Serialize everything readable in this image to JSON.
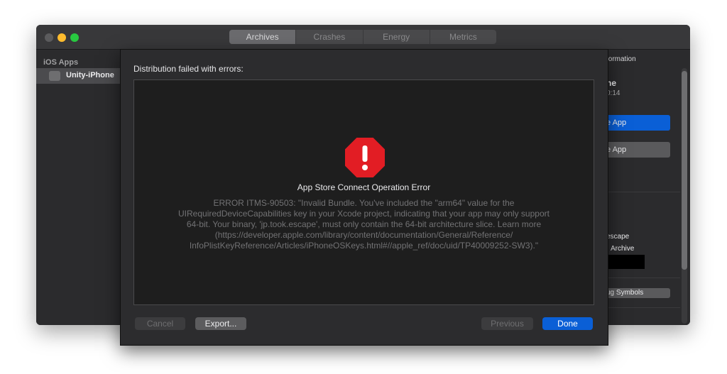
{
  "window": {
    "tabs": [
      {
        "label": "Archives",
        "active": true
      },
      {
        "label": "Crashes",
        "active": false
      },
      {
        "label": "Energy",
        "active": false
      },
      {
        "label": "Metrics",
        "active": false
      }
    ]
  },
  "sidebar": {
    "heading": "iOS Apps",
    "items": [
      {
        "label": "Unity-iPhone",
        "icon": "app-icon"
      }
    ]
  },
  "right_panel": {
    "heading": "formation",
    "name": "ne",
    "time": "0:14",
    "primary_button": "e App",
    "secondary_button": "e App",
    "identifier": "escape",
    "archive_label": "Archive",
    "symbols_button": "ug Symbols"
  },
  "sheet": {
    "title": "Distribution failed with errors:",
    "error_title": "App Store Connect Operation Error",
    "error_lines": [
      "ERROR ITMS-90503: \"Invalid Bundle. You've included the \"arm64\" value for the",
      "UIRequiredDeviceCapabilities key in your Xcode project, indicating that your app may only support",
      "64-bit. Your binary, 'jp.took.escape', must only contain the 64-bit architecture slice. Learn more",
      "(https://developer.apple.com/library/content/documentation/General/Reference/",
      "InfoPlistKeyReference/Articles/iPhoneOSKeys.html#//apple_ref/doc/uid/TP40009252-SW3).\""
    ],
    "buttons": {
      "cancel": "Cancel",
      "export": "Export...",
      "previous": "Previous",
      "done": "Done"
    }
  },
  "colors": {
    "accent": "#0a5fd6",
    "error": "#e21d24"
  }
}
